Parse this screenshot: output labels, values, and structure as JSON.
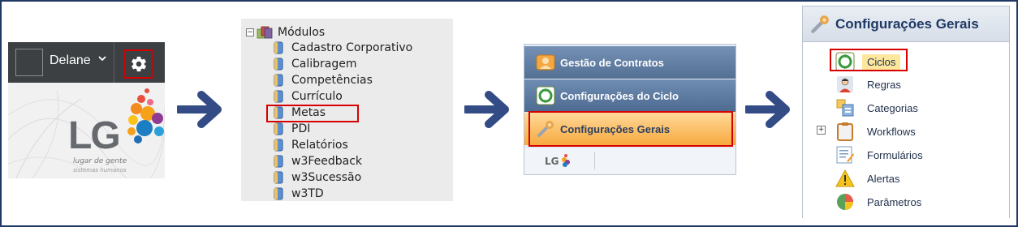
{
  "panel_header": {
    "user_name": "Delane",
    "chevron": "⌄",
    "gear_icon": "gear-icon",
    "logo_text": "LG",
    "logo_tagline": "lugar de gente",
    "logo_sub": "sistemas humanos"
  },
  "modules_tree": {
    "root_toggle": "−",
    "root_label": "Módulos",
    "items": [
      {
        "label": "Cadastro Corporativo"
      },
      {
        "label": "Calibragem"
      },
      {
        "label": "Competências"
      },
      {
        "label": "Currículo"
      },
      {
        "label": "Metas",
        "highlighted": true
      },
      {
        "label": "PDI"
      },
      {
        "label": "Relatórios"
      },
      {
        "label": "w3Feedback"
      },
      {
        "label": "w3Sucessão"
      },
      {
        "label": "w3TD"
      }
    ]
  },
  "side_menu": {
    "items": [
      {
        "label": "Gestão de Contratos",
        "icon": "contracts-icon"
      },
      {
        "label": "Configurações do Ciclo",
        "icon": "cycle-icon"
      },
      {
        "label": "Configurações Gerais",
        "icon": "wrench-icon",
        "selected": true
      }
    ],
    "footer_logo": "LG"
  },
  "config_panel": {
    "title": "Configurações Gerais",
    "items": [
      {
        "label": "Ciclos",
        "icon": "cycle-icon",
        "highlighted": true
      },
      {
        "label": "Regras",
        "icon": "person-icon"
      },
      {
        "label": "Categorias",
        "icon": "categories-icon"
      },
      {
        "label": "Workflows",
        "icon": "clipboard-icon",
        "expandable": true
      },
      {
        "label": "Formulários",
        "icon": "form-icon"
      },
      {
        "label": "Alertas",
        "icon": "warning-icon"
      },
      {
        "label": "Parâmetros",
        "icon": "pie-chart-icon"
      }
    ],
    "workflows_toggle": "+"
  },
  "colors": {
    "border": "#1f3864",
    "arrow": "#334c86",
    "highlight": "#d60000",
    "header_bar": "#3c4043",
    "menu_selected": "#f7a93e"
  }
}
